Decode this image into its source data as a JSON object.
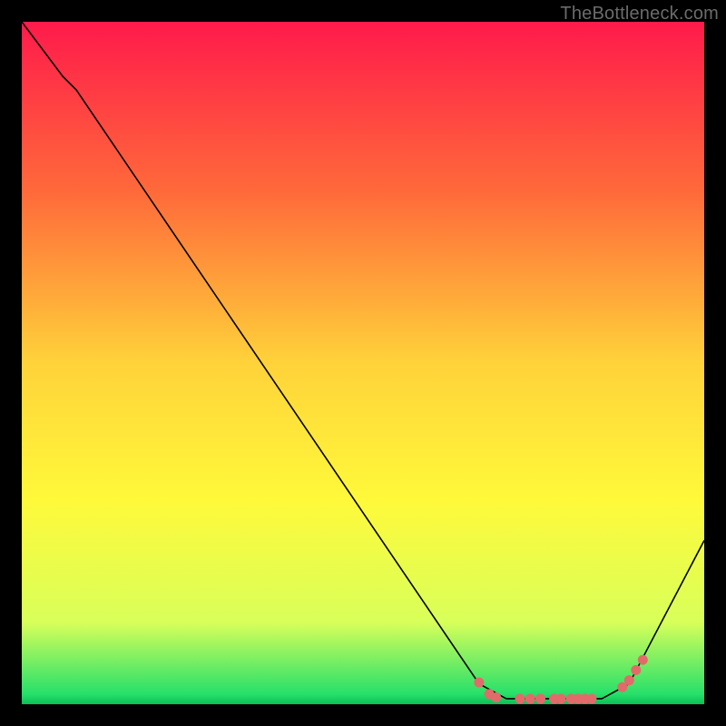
{
  "watermark": "TheBottleneck.com",
  "chart_data": {
    "type": "line",
    "title": "",
    "xlabel": "",
    "ylabel": "",
    "xlim": [
      0,
      100
    ],
    "ylim": [
      0,
      100
    ],
    "grid": false,
    "legend": false,
    "gradient_stops": [
      {
        "offset": 0,
        "color": "#ff1a4b"
      },
      {
        "offset": 0.25,
        "color": "#ff6a3a"
      },
      {
        "offset": 0.5,
        "color": "#ffd23a"
      },
      {
        "offset": 0.7,
        "color": "#fff93a"
      },
      {
        "offset": 0.88,
        "color": "#d8ff5a"
      },
      {
        "offset": 0.985,
        "color": "#27e06a"
      },
      {
        "offset": 1.0,
        "color": "#0bbf55"
      }
    ],
    "series": [
      {
        "name": "curve",
        "stroke": "#000000",
        "stroke_width": 1.6,
        "points": [
          {
            "x": 0,
            "y": 100
          },
          {
            "x": 6,
            "y": 92
          },
          {
            "x": 8,
            "y": 90
          },
          {
            "x": 67,
            "y": 3
          },
          {
            "x": 71,
            "y": 0.8
          },
          {
            "x": 85,
            "y": 0.8
          },
          {
            "x": 89,
            "y": 3
          },
          {
            "x": 100,
            "y": 24
          }
        ]
      }
    ],
    "markers": {
      "color": "#e36a6a",
      "radius": 5.5,
      "points": [
        {
          "x": 67,
          "y": 3.2
        },
        {
          "x": 68.5,
          "y": 1.5
        },
        {
          "x": 69.5,
          "y": 1.0
        },
        {
          "x": 73,
          "y": 0.8
        },
        {
          "x": 74.5,
          "y": 0.8
        },
        {
          "x": 76,
          "y": 0.8
        },
        {
          "x": 78,
          "y": 0.8
        },
        {
          "x": 79,
          "y": 0.8
        },
        {
          "x": 80.5,
          "y": 0.8
        },
        {
          "x": 81.5,
          "y": 0.8
        },
        {
          "x": 82.5,
          "y": 0.8
        },
        {
          "x": 83.5,
          "y": 0.8
        },
        {
          "x": 88,
          "y": 2.5
        },
        {
          "x": 89,
          "y": 3.5
        },
        {
          "x": 90,
          "y": 5.0
        },
        {
          "x": 91,
          "y": 6.5
        }
      ]
    }
  }
}
